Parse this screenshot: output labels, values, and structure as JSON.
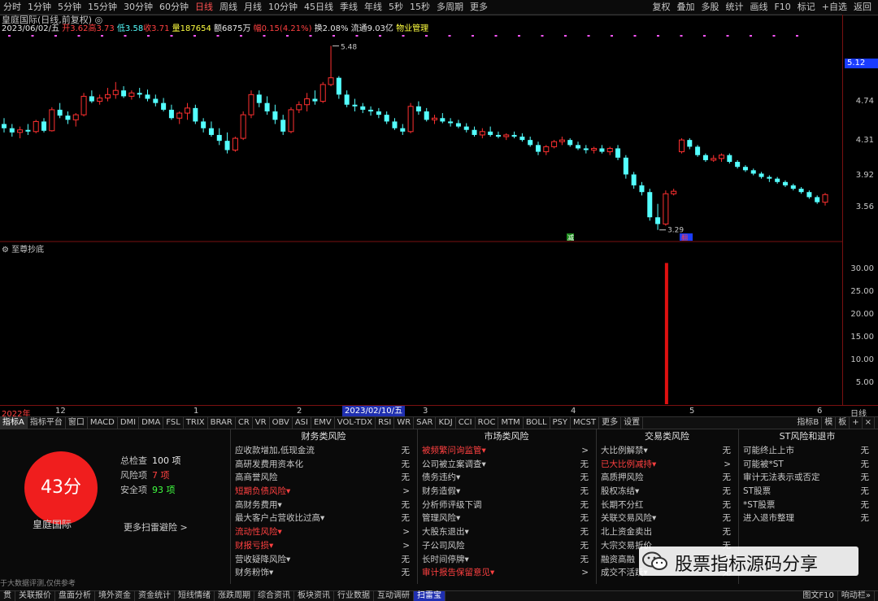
{
  "toolbar": {
    "periods": [
      "分时",
      "1分钟",
      "5分钟",
      "15分钟",
      "30分钟",
      "60分钟",
      "日线",
      "周线",
      "月线",
      "10分钟",
      "45日线",
      "季线",
      "年线",
      "5秒",
      "15秒",
      "多周期",
      "更多"
    ],
    "active_period": "日线",
    "right_tools": [
      "复权",
      "叠加",
      "多股",
      "统计",
      "画线",
      "F10",
      "标记",
      "+自选",
      "返回"
    ]
  },
  "stock": {
    "title": "皇庭国际(日线,前复权) ◎",
    "date": "2023/06/02/五",
    "open": "开3.62",
    "high": "高3.73",
    "low": "低3.58",
    "close": "收3.71",
    "volume": "量187654",
    "amount": "额6875万",
    "change": "幅0.15(4.21%)",
    "turnover": "换2.08%",
    "float": "流通9.03亿",
    "sector": "物业管理"
  },
  "price_axis": [
    "5.12",
    "4.74",
    "4.31",
    "3.92",
    "3.56"
  ],
  "annotations": {
    "high_mark": "5.48",
    "low_mark": "3.29",
    "tag_jian": "减",
    "tag_fan": "翻"
  },
  "indicator": {
    "name": "至尊抄底",
    "axis": [
      "30.00",
      "25.00",
      "20.00",
      "15.00",
      "10.00",
      "5.00"
    ]
  },
  "dates": {
    "labels": [
      "2022年",
      "12",
      "1",
      "2",
      "3",
      "4",
      "5",
      "6"
    ],
    "cursor": "2023/02/10/五",
    "right_label": "日线"
  },
  "tabs": {
    "items": [
      "指标A",
      "指标平台",
      "窗口",
      "MACD",
      "DMI",
      "DMA",
      "FSL",
      "TRIX",
      "BRAR",
      "CR",
      "VR",
      "OBV",
      "ASI",
      "EMV",
      "VOL-TDX",
      "RSI",
      "WR",
      "SAR",
      "KDJ",
      "CCI",
      "ROC",
      "MTM",
      "BOLL",
      "PSY",
      "MCST",
      "更多",
      "设置"
    ],
    "right": [
      "指标B",
      "模",
      "板",
      "+",
      "×"
    ]
  },
  "risk": {
    "score": "43分",
    "company": "皇庭国际",
    "total_label": "总检查",
    "total_value": "100 项",
    "risk_label": "风险项",
    "risk_value": "7 项",
    "safe_label": "安全项",
    "safe_value": "93 项",
    "more_scan": "更多扫雷避险 >",
    "disclaimer": "于大数据评测,仅供参考"
  },
  "risk_columns": [
    {
      "header": "财务类风险",
      "rows": [
        {
          "text": "应收款增加,低现金流",
          "value": "无",
          "warn": false
        },
        {
          "text": "高研发费用资本化",
          "value": "无",
          "warn": false
        },
        {
          "text": "高商誉风险",
          "value": "无",
          "warn": false
        },
        {
          "text": "短期负债风险▾",
          "value": ">",
          "warn": true
        },
        {
          "text": "高财务费用▾",
          "value": "无",
          "warn": false
        },
        {
          "text": "最大客户占营收比过高▾",
          "value": "无",
          "warn": false
        },
        {
          "text": "流动性风险▾",
          "value": ">",
          "warn": true
        },
        {
          "text": "财报亏损▾",
          "value": ">",
          "warn": true
        },
        {
          "text": "营收疑降风险▾",
          "value": "无",
          "warn": false
        },
        {
          "text": "财务粉饰▾",
          "value": "无",
          "warn": false
        }
      ]
    },
    {
      "header": "市场类风险",
      "rows": [
        {
          "text": "被频繁问询监管▾",
          "value": ">",
          "warn": true
        },
        {
          "text": "公司被立案调查▾",
          "value": "无",
          "warn": false
        },
        {
          "text": "债务违约▾",
          "value": "无",
          "warn": false
        },
        {
          "text": "财务造假▾",
          "value": "无",
          "warn": false
        },
        {
          "text": "分析师评级下调",
          "value": "无",
          "warn": false
        },
        {
          "text": "管理风险▾",
          "value": "无",
          "warn": false
        },
        {
          "text": "大股东退出▾",
          "value": "无",
          "warn": false
        },
        {
          "text": "子公司风险",
          "value": "无",
          "warn": false
        },
        {
          "text": "长时间停牌▾",
          "value": "无",
          "warn": false
        },
        {
          "text": "审计报告保留意见▾",
          "value": ">",
          "warn": true
        }
      ]
    },
    {
      "header": "交易类风险",
      "rows": [
        {
          "text": "大比例解禁▾",
          "value": "无",
          "warn": false
        },
        {
          "text": "已大比例减持▾",
          "value": ">",
          "warn": true
        },
        {
          "text": "高质押风险",
          "value": "无",
          "warn": false
        },
        {
          "text": "股权冻结▾",
          "value": "无",
          "warn": false
        },
        {
          "text": "长期不分红",
          "value": "无",
          "warn": false
        },
        {
          "text": "关联交易风险▾",
          "value": "无",
          "warn": false
        },
        {
          "text": "北上资金卖出",
          "value": "无",
          "warn": false
        },
        {
          "text": "大宗交易折价",
          "value": "无",
          "warn": false
        },
        {
          "text": "融资高融",
          "value": "无",
          "warn": false
        },
        {
          "text": "成交不活跃▾",
          "value": "无",
          "warn": false
        }
      ]
    },
    {
      "header": "ST风险和退市",
      "rows": [
        {
          "text": "可能终止上市",
          "value": "无",
          "warn": false
        },
        {
          "text": "可能被*ST",
          "value": "无",
          "warn": false
        },
        {
          "text": "审计无法表示或否定",
          "value": "无",
          "warn": false
        },
        {
          "text": "ST股票",
          "value": "无",
          "warn": false
        },
        {
          "text": "*ST股票",
          "value": "无",
          "warn": false
        },
        {
          "text": "进入退市整理",
          "value": "无",
          "warn": false
        }
      ]
    }
  ],
  "bottom_tabs": {
    "items": [
      "贯",
      "关联报价",
      "盘面分析",
      "境外资金",
      "资金统计",
      "短线情绪",
      "涨跌周期",
      "综合资讯",
      "板块资讯",
      "行业数据",
      "互动调研",
      "扫雷宝"
    ],
    "active": "扫雷宝",
    "right": [
      "图文F10",
      "响动栏»"
    ]
  },
  "watermark": {
    "text": "股票指标源码分享"
  },
  "colors": {
    "up": "#ff3030",
    "down": "#54ffff",
    "accent": "#1f2fb0",
    "score_bg": "#f01e1e"
  },
  "chart_data": {
    "type": "candlestick",
    "indicator_type": "bar",
    "ylim": [
      3.2,
      5.6
    ],
    "candles": [
      [
        4.55,
        4.62,
        4.45,
        4.5
      ],
      [
        4.5,
        4.55,
        4.4,
        4.45
      ],
      [
        4.45,
        4.52,
        4.38,
        4.48
      ],
      [
        4.48,
        4.55,
        4.42,
        4.46
      ],
      [
        4.46,
        4.6,
        4.44,
        4.58
      ],
      [
        4.58,
        4.62,
        4.45,
        4.47
      ],
      [
        4.47,
        4.75,
        4.46,
        4.72
      ],
      [
        4.72,
        4.8,
        4.62,
        4.65
      ],
      [
        4.65,
        4.7,
        4.55,
        4.6
      ],
      [
        4.6,
        4.68,
        4.52,
        4.66
      ],
      [
        4.66,
        4.92,
        4.64,
        4.88
      ],
      [
        4.88,
        4.95,
        4.8,
        4.82
      ],
      [
        4.82,
        4.9,
        4.78,
        4.86
      ],
      [
        4.86,
        4.98,
        4.82,
        4.9
      ],
      [
        4.9,
        5.05,
        4.85,
        4.95
      ],
      [
        4.95,
        5.0,
        4.86,
        4.88
      ],
      [
        4.88,
        4.95,
        4.84,
        4.92
      ],
      [
        4.92,
        4.98,
        4.86,
        4.9
      ],
      [
        4.9,
        4.96,
        4.82,
        4.85
      ],
      [
        4.85,
        4.9,
        4.76,
        4.8
      ],
      [
        4.8,
        4.86,
        4.7,
        4.72
      ],
      [
        4.72,
        4.78,
        4.6,
        4.62
      ],
      [
        4.62,
        4.7,
        4.55,
        4.68
      ],
      [
        4.68,
        4.8,
        4.6,
        4.74
      ],
      [
        4.74,
        4.78,
        4.55,
        4.58
      ],
      [
        4.58,
        4.62,
        4.45,
        4.5
      ],
      [
        4.5,
        4.58,
        4.4,
        4.42
      ],
      [
        4.42,
        4.5,
        4.3,
        4.35
      ],
      [
        4.35,
        4.45,
        4.2,
        4.24
      ],
      [
        4.24,
        4.4,
        4.22,
        4.38
      ],
      [
        4.38,
        4.7,
        4.36,
        4.66
      ],
      [
        4.66,
        4.95,
        4.62,
        4.9
      ],
      [
        4.9,
        4.95,
        4.75,
        4.8
      ],
      [
        4.8,
        4.88,
        4.66,
        4.7
      ],
      [
        4.7,
        4.78,
        4.55,
        4.6
      ],
      [
        4.6,
        4.66,
        4.42,
        4.46
      ],
      [
        4.46,
        4.75,
        4.44,
        4.72
      ],
      [
        4.72,
        4.82,
        4.68,
        4.78
      ],
      [
        4.78,
        4.92,
        4.7,
        4.85
      ],
      [
        4.85,
        4.95,
        4.78,
        4.82
      ],
      [
        4.82,
        5.05,
        4.8,
        5.02
      ],
      [
        5.02,
        5.48,
        5.0,
        5.1
      ],
      [
        5.1,
        5.12,
        4.85,
        4.9
      ],
      [
        4.9,
        4.95,
        4.75,
        4.78
      ],
      [
        4.78,
        4.85,
        4.7,
        4.76
      ],
      [
        4.76,
        4.8,
        4.68,
        4.72
      ],
      [
        4.72,
        4.76,
        4.65,
        4.7
      ],
      [
        4.7,
        4.74,
        4.62,
        4.66
      ],
      [
        4.66,
        4.7,
        4.55,
        4.58
      ],
      [
        4.58,
        4.62,
        4.48,
        4.5
      ],
      [
        4.5,
        4.55,
        4.42,
        4.46
      ],
      [
        4.46,
        4.8,
        4.44,
        4.76
      ],
      [
        4.76,
        4.82,
        4.66,
        4.7
      ],
      [
        4.7,
        4.74,
        4.58,
        4.6
      ],
      [
        4.6,
        4.66,
        4.55,
        4.62
      ],
      [
        4.62,
        4.68,
        4.56,
        4.58
      ],
      [
        4.58,
        4.62,
        4.52,
        4.56
      ],
      [
        4.56,
        4.6,
        4.5,
        4.52
      ],
      [
        4.52,
        4.56,
        4.45,
        4.48
      ],
      [
        4.48,
        4.52,
        4.4,
        4.42
      ],
      [
        4.42,
        4.5,
        4.38,
        4.46
      ],
      [
        4.46,
        4.52,
        4.4,
        4.42
      ],
      [
        4.42,
        4.46,
        4.38,
        4.4
      ],
      [
        4.4,
        4.44,
        4.36,
        4.42
      ],
      [
        4.42,
        4.46,
        4.38,
        4.4
      ],
      [
        4.4,
        4.44,
        4.34,
        4.36
      ],
      [
        4.36,
        4.4,
        4.28,
        4.3
      ],
      [
        4.3,
        4.34,
        4.18,
        4.22
      ],
      [
        4.22,
        4.3,
        4.18,
        4.28
      ],
      [
        4.28,
        4.36,
        4.26,
        4.34
      ],
      [
        4.34,
        4.4,
        4.3,
        4.36
      ],
      [
        4.36,
        4.38,
        4.28,
        4.3
      ],
      [
        4.3,
        4.34,
        4.24,
        4.26
      ],
      [
        4.26,
        4.3,
        4.2,
        4.24
      ],
      [
        4.24,
        4.28,
        4.2,
        4.26
      ],
      [
        4.26,
        4.3,
        4.2,
        4.22
      ],
      [
        4.22,
        4.28,
        4.18,
        4.26
      ],
      [
        4.26,
        4.3,
        4.12,
        4.15
      ],
      [
        4.15,
        4.18,
        3.9,
        3.95
      ],
      [
        3.95,
        3.98,
        3.78,
        3.82
      ],
      [
        3.82,
        3.86,
        3.7,
        3.74
      ],
      [
        3.74,
        3.78,
        3.4,
        3.44
      ],
      [
        3.44,
        3.6,
        3.29,
        3.36
      ],
      [
        3.36,
        3.76,
        3.34,
        3.72
      ],
      [
        3.72,
        3.78,
        3.7,
        3.75
      ],
      [
        4.22,
        4.38,
        4.2,
        4.36
      ],
      [
        4.36,
        4.38,
        4.25,
        4.28
      ],
      [
        4.28,
        4.3,
        4.16,
        4.18
      ],
      [
        4.18,
        4.2,
        4.1,
        4.12
      ],
      [
        4.12,
        4.18,
        4.1,
        4.14
      ],
      [
        4.14,
        4.2,
        4.1,
        4.18
      ],
      [
        4.18,
        4.2,
        4.08,
        4.1
      ],
      [
        4.1,
        4.12,
        4.02,
        4.04
      ],
      [
        4.04,
        4.06,
        3.98,
        4.0
      ],
      [
        4.0,
        4.02,
        3.94,
        3.96
      ],
      [
        3.96,
        3.98,
        3.9,
        3.92
      ],
      [
        3.92,
        3.94,
        3.86,
        3.9
      ],
      [
        3.9,
        3.92,
        3.84,
        3.86
      ],
      [
        3.86,
        3.88,
        3.8,
        3.82
      ],
      [
        3.82,
        3.84,
        3.76,
        3.78
      ],
      [
        3.78,
        3.8,
        3.72,
        3.74
      ],
      [
        3.74,
        3.76,
        3.66,
        3.68
      ],
      [
        3.68,
        3.7,
        3.6,
        3.62
      ],
      [
        3.62,
        3.73,
        3.58,
        3.71
      ]
    ],
    "indicator_values": [
      {
        "index": 83,
        "value": 32.5
      }
    ],
    "indicator_ylim": [
      0,
      35
    ]
  }
}
